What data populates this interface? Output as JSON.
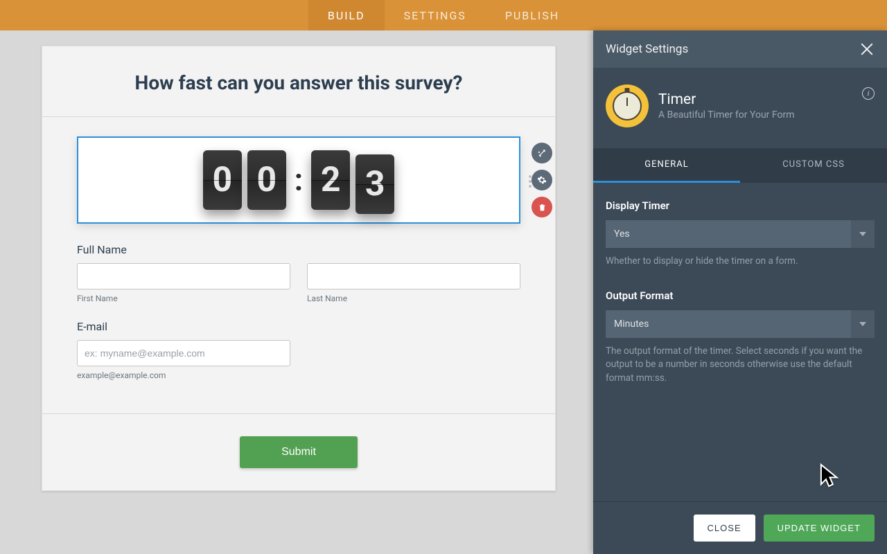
{
  "nav": {
    "tabs": [
      "BUILD",
      "SETTINGS",
      "PUBLISH"
    ],
    "active": 0
  },
  "form": {
    "title": "How fast can you answer this survey?",
    "timer": {
      "digits": [
        "0",
        "0",
        "2",
        "3"
      ],
      "colon": ":"
    },
    "fullname": {
      "label": "Full Name",
      "first_sub": "First Name",
      "last_sub": "Last Name"
    },
    "email": {
      "label": "E-mail",
      "placeholder": "ex: myname@example.com",
      "help": "example@example.com"
    },
    "submit": "Submit"
  },
  "panel": {
    "title": "Widget Settings",
    "widget_name": "Timer",
    "widget_desc": "A Beautiful Timer for Your Form",
    "tabs": [
      "GENERAL",
      "CUSTOM CSS"
    ],
    "active_tab": 0,
    "display_timer": {
      "label": "Display Timer",
      "value": "Yes",
      "help": "Whether to display or hide the timer on a form."
    },
    "output_format": {
      "label": "Output Format",
      "value": "Minutes",
      "help": "The output format of the timer. Select seconds if you want the output to be a number in seconds otherwise use the default format mm:ss."
    },
    "close_btn": "CLOSE",
    "update_btn": "UPDATE WIDGET"
  }
}
